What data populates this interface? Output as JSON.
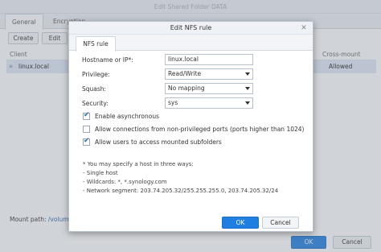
{
  "background": {
    "title": "Edit Shared Folder DATA",
    "tabs": [
      {
        "label": "General"
      },
      {
        "label": "Encryption"
      }
    ],
    "toolbar": {
      "create": "Create",
      "edit": "Edit"
    },
    "table": {
      "headers": {
        "client": "Client",
        "cross_mount": "Cross-mount"
      },
      "rows": [
        {
          "client": "linux.local",
          "cross_mount": "Allowed"
        }
      ]
    },
    "mount_path_label": "Mount path:",
    "mount_path_value": "/volume",
    "footer": {
      "ok": "OK",
      "cancel": "Cancel"
    }
  },
  "dialog": {
    "title": "Edit NFS rule",
    "tab": "NFS rule",
    "hostname_label": "Hostname or IP*:",
    "hostname_value": "linux.local",
    "privilege_label": "Privilege:",
    "privilege_value": "Read/Write",
    "squash_label": "Squash:",
    "squash_value": "No mapping",
    "security_label": "Security:",
    "security_value": "sys",
    "checkboxes": [
      {
        "label": "Enable asynchronous",
        "checked": true
      },
      {
        "label": "Allow connections from non-privileged ports (ports higher than 1024)",
        "checked": false
      },
      {
        "label": "Allow users to access mounted subfolders",
        "checked": true
      }
    ],
    "note": {
      "intro": "* You may specify a host in three ways:",
      "single": "- Single host",
      "wildcards": "- Wildcards: *, *.synology.com",
      "network": "- Network segment: 203.74.205.32/255.255.255.0, 203.74.205.32/24"
    },
    "ok": "OK",
    "cancel": "Cancel"
  },
  "colors": {
    "accent": "#1f7fe0",
    "selected_row": "#dfe9f5"
  }
}
